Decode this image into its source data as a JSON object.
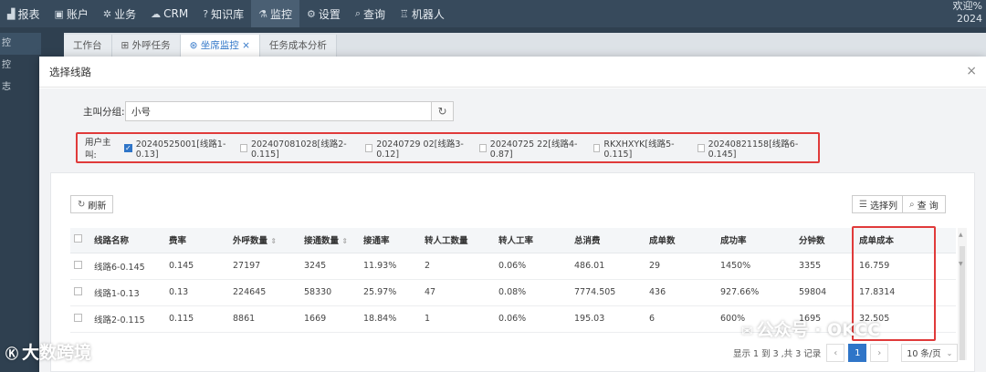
{
  "topnav": {
    "items": [
      {
        "icon": "chart-icon",
        "glyph": "▟",
        "label": "报表"
      },
      {
        "icon": "account-icon",
        "glyph": "▣",
        "label": "账户"
      },
      {
        "icon": "gear-icon",
        "glyph": "✲",
        "label": "业务"
      },
      {
        "icon": "crm-icon",
        "glyph": "☁",
        "label": "CRM"
      },
      {
        "icon": "help-icon",
        "glyph": "?",
        "label": "知识库"
      },
      {
        "icon": "monitor-icon",
        "glyph": "⚗",
        "label": "监控"
      },
      {
        "icon": "settings-icon",
        "glyph": "⚙",
        "label": "设置"
      },
      {
        "icon": "search-icon",
        "glyph": "⌕",
        "label": "查询"
      },
      {
        "icon": "robot-icon",
        "glyph": "♖",
        "label": "机器人"
      }
    ],
    "welcome_line1": "欢迎%",
    "welcome_line2": "2024"
  },
  "sidebar": {
    "items": [
      "控",
      "控",
      "志"
    ]
  },
  "tabs": [
    {
      "label": "工作台"
    },
    {
      "label": "⊞ 外呼任务"
    },
    {
      "label": "⊛ 坐席监控 ×"
    },
    {
      "label": "任务成本分析"
    }
  ],
  "modal": {
    "title": "选择线路",
    "close": "×",
    "group_label": "主叫分组:",
    "group_value": "小号",
    "caller_label": "用户主叫:",
    "callers": [
      {
        "label": "20240525001[线路1-0.13]",
        "checked": true
      },
      {
        "label": "202407081028[线路2-0.115]",
        "checked": false
      },
      {
        "label": "20240729 02[线路3-0.12]",
        "checked": false
      },
      {
        "label": "20240725 22[线路4-0.87]",
        "checked": false
      },
      {
        "label": "RKXHXYK[线路5-0.115]",
        "checked": false
      },
      {
        "label": "20240821158[线路6-0.145]",
        "checked": false
      }
    ],
    "refresh_label": "刷新",
    "columns_label": "选择列",
    "query_label": "查 询"
  },
  "table": {
    "headers": [
      "线路名称",
      "费率",
      "外呼数量",
      "接通数量",
      "接通率",
      "转人工数量",
      "转人工率",
      "总消费",
      "成单数",
      "成功率",
      "分钟数",
      "成单成本"
    ],
    "rows": [
      [
        "线路6-0.145",
        "0.145",
        "27197",
        "3245",
        "11.93%",
        "2",
        "0.06%",
        "486.01",
        "29",
        "1450%",
        "3355",
        "16.759"
      ],
      [
        "线路1-0.13",
        "0.13",
        "224645",
        "58330",
        "25.97%",
        "47",
        "0.08%",
        "7774.505",
        "436",
        "927.66%",
        "59804",
        "17.8314"
      ],
      [
        "线路2-0.115",
        "0.115",
        "8861",
        "1669",
        "18.84%",
        "1",
        "0.06%",
        "195.03",
        "6",
        "600%",
        "1695",
        "32.505"
      ]
    ]
  },
  "pager": {
    "summary": "显示 1 到 3 ,共 3 记录",
    "prev": "‹",
    "current": "1",
    "next": "›",
    "page_size": "10 条/页"
  },
  "watermarks": {
    "logo_text": "大数跨境",
    "wechat_text": "公众号 · OKCC"
  },
  "colors": {
    "accent": "#2f75c8",
    "highlight": "#e03a3a"
  }
}
